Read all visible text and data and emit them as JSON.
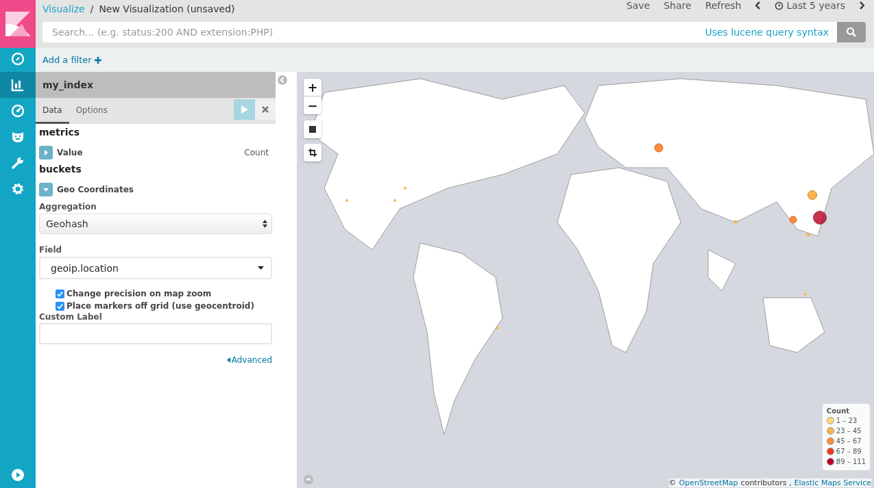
{
  "breadcrumb": {
    "parent": "Visualize",
    "separator": "/",
    "current": "New Visualization (unsaved)"
  },
  "top_actions": [
    "Save",
    "Share",
    "Refresh"
  ],
  "time_range": "Last 5 years",
  "search": {
    "placeholder": "Search... (e.g. status:200 AND extension:PHP)",
    "hint": "Uses lucene query syntax"
  },
  "add_filter": "Add a filter",
  "nav": [
    {
      "selected": false
    },
    {
      "selected": true
    },
    {
      "selected": false
    },
    {
      "selected": false
    },
    {
      "selected": false
    },
    {
      "selected": false
    }
  ],
  "panel": {
    "index": "my_index",
    "tabs": [
      {
        "label": "Data",
        "selected": true
      },
      {
        "label": "Options",
        "selected": false
      }
    ],
    "metrics_heading": "metrics",
    "metric": {
      "label": "Value",
      "value": "Count",
      "expanded": false
    },
    "buckets_heading": "buckets",
    "bucket": {
      "label": "Geo Coordinates",
      "expanded": true
    },
    "aggregation": {
      "label": "Aggregation",
      "value": "Geohash"
    },
    "field": {
      "label": "Field",
      "value": "geoip.location"
    },
    "checkboxes": [
      {
        "label": "Change precision on map zoom",
        "checked": true
      },
      {
        "label": "Place markers off grid (use geocentroid)",
        "checked": true
      }
    ],
    "custom_label": {
      "label": "Custom Label"
    },
    "advanced": "Advanced"
  },
  "map": {
    "zoom_in": "+",
    "zoom_out": "−",
    "legend": {
      "title": "Count",
      "items": [
        {
          "label": "1 – 23",
          "color": "#fed976"
        },
        {
          "label": "23 – 45",
          "color": "#feb24c"
        },
        {
          "label": "45 – 67",
          "color": "#fd8d3c"
        },
        {
          "label": "67 – 89",
          "color": "#f03b20"
        },
        {
          "label": "89 – 111",
          "color": "#bd0026"
        }
      ]
    },
    "attribution": {
      "prefix": "©",
      "osm": "OpenStreetMap",
      "middle": "contributors ,",
      "ems": "Elastic Maps Service"
    }
  }
}
